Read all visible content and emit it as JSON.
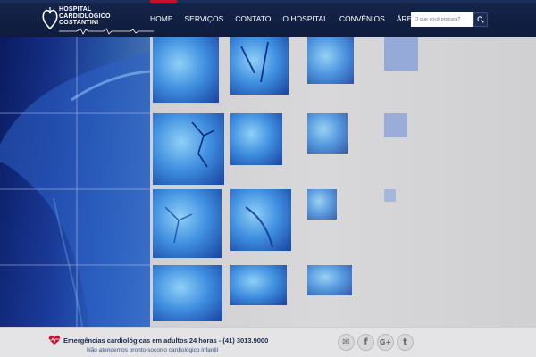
{
  "header": {
    "logo_lines": [
      "HOSPITAL",
      "CARDIOLÓGICO",
      "COSTANTINI"
    ],
    "nav": [
      {
        "label": "HOME"
      },
      {
        "label": "SERVIÇOS"
      },
      {
        "label": "CONTATO"
      },
      {
        "label": "O HOSPITAL"
      },
      {
        "label": "CONVÊNIOS"
      },
      {
        "label": "ÁREA MÉDICA"
      }
    ],
    "search": {
      "placeholder": "O que você procura?",
      "icon": "search-icon"
    }
  },
  "hero": {
    "description": "anatomical heart and shoulder image in blue mosaic tiles"
  },
  "footer": {
    "emergency_text": "Emergências cardiológicas em adultos 24 horas - (41) 3013.9000",
    "sub_text": "Não atendemos pronto-socorro cardiológico infantil",
    "social": [
      {
        "icon": "email-icon",
        "glyph": "✉"
      },
      {
        "icon": "facebook-icon",
        "glyph": "f"
      },
      {
        "icon": "google-plus-icon",
        "glyph": "G+"
      },
      {
        "icon": "twitter-icon",
        "glyph": "t"
      }
    ]
  },
  "colors": {
    "header_bg": "#15244a",
    "accent_red": "#c8102e",
    "tile_blue": "#2f7fd6"
  }
}
